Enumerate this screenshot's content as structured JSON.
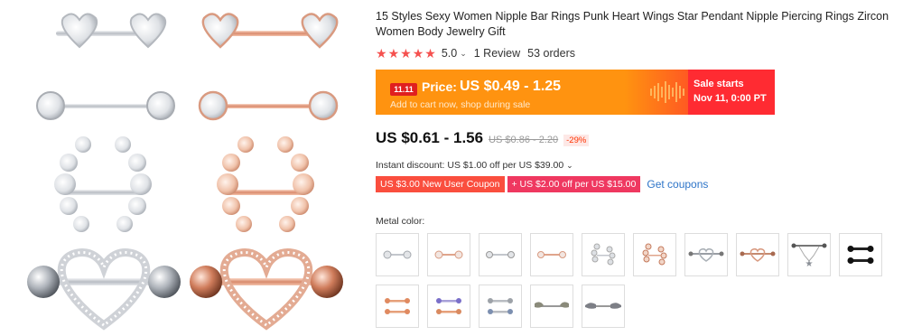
{
  "product": {
    "title": "15 Styles Sexy Women Nipple Bar Rings Punk Heart Wings Star Pendant Nipple Piercing Rings Zircon Women Body Jewelry Gift",
    "rating": "5.0",
    "rating_chevron": "⌄",
    "stars": 5,
    "reviews": "1 Review",
    "orders": "53 orders"
  },
  "banner": {
    "badge": "11.11",
    "price_label": "Price:",
    "price_value": "US $0.49 - 1.25",
    "subtext": "Add to cart now, shop during sale",
    "sale_label": "Sale starts",
    "sale_date": "Nov 11, 0:00 PT"
  },
  "pricing": {
    "current": "US $0.61 - 1.56",
    "original": "US $0.86 - 2.20",
    "discount": "-29%"
  },
  "instant_discount": "Instant discount: US $1.00 off per US $39.00",
  "instant_chevron": "⌄",
  "coupons": {
    "new_user": "US $3.00 New User Coupon",
    "store": "+ US $2.00 off per US $15.00",
    "get_link": "Get coupons"
  },
  "metal_color": {
    "label": "Metal color:",
    "swatch_count": 15,
    "icons": [
      "silver-heart-bar",
      "rose-heart-bar",
      "silver-round-bar",
      "rose-round-bar",
      "silver-wing-clip",
      "rose-wing-clip",
      "silver-heart-shield",
      "rose-heart-shield",
      "silver-star-pendant",
      "black-barbell",
      "rose-purple-barbell",
      "purple-barbell",
      "silver-barbell",
      "feather-bar",
      "wing-bar"
    ]
  },
  "colors": {
    "accent": "#f5514f",
    "banner_orange": "#ff9310",
    "banner_red": "#ff2b32",
    "link": "#2e75c8",
    "silver": "#c9ccd1",
    "rose": "#e8a58a"
  }
}
